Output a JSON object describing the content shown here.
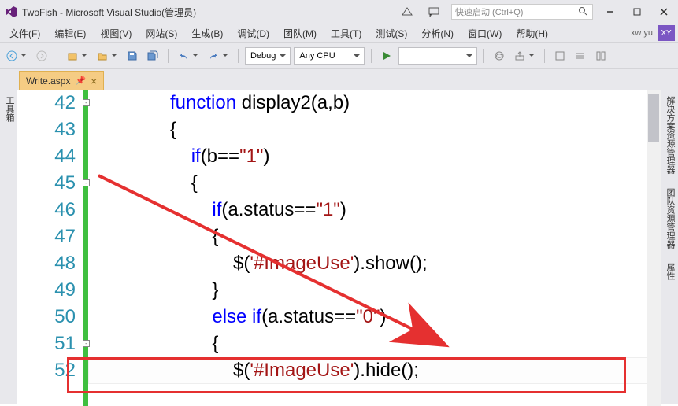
{
  "title": "TwoFish - Microsoft Visual Studio(管理员)",
  "quick_launch_placeholder": "快速启动 (Ctrl+Q)",
  "menu": {
    "file": "文件(F)",
    "edit": "编辑(E)",
    "view": "视图(V)",
    "site": "网站(S)",
    "build": "生成(B)",
    "debug": "调试(D)",
    "team": "团队(M)",
    "tools": "工具(T)",
    "test": "测试(S)",
    "analyze": "分析(N)",
    "window": "窗口(W)",
    "help": "帮助(H)"
  },
  "user": {
    "name": "xw yu",
    "initials": "XY"
  },
  "toolbar": {
    "config": "Debug",
    "platform": "Any CPU"
  },
  "tab": {
    "name": "Write.aspx"
  },
  "rails": {
    "left": "工具箱",
    "right": [
      "解决方案资源管理器",
      "团队资源管理器",
      "属性"
    ]
  },
  "code": {
    "lines": [
      {
        "n": 42,
        "fold": true,
        "indent": 3,
        "tokens": [
          {
            "t": "function ",
            "c": "kw"
          },
          {
            "t": "display2(a,b)"
          }
        ]
      },
      {
        "n": 43,
        "indent": 3,
        "tokens": [
          {
            "t": "{"
          }
        ]
      },
      {
        "n": 44,
        "indent": 4,
        "tokens": [
          {
            "t": "if",
            "c": "kw"
          },
          {
            "t": "(b=="
          },
          {
            "t": "\"1\"",
            "c": "str"
          },
          {
            "t": ")"
          }
        ]
      },
      {
        "n": 45,
        "fold": true,
        "indent": 4,
        "tokens": [
          {
            "t": "{"
          }
        ]
      },
      {
        "n": 46,
        "indent": 5,
        "tokens": [
          {
            "t": "if",
            "c": "kw"
          },
          {
            "t": "(a.status=="
          },
          {
            "t": "\"1\"",
            "c": "str"
          },
          {
            "t": ")"
          }
        ]
      },
      {
        "n": 47,
        "indent": 5,
        "tokens": [
          {
            "t": "{"
          }
        ]
      },
      {
        "n": 48,
        "indent": 6,
        "tokens": [
          {
            "t": "$("
          },
          {
            "t": "'#ImageUse'",
            "c": "str"
          },
          {
            "t": ").show();"
          }
        ]
      },
      {
        "n": 49,
        "indent": 5,
        "tokens": [
          {
            "t": "}"
          }
        ]
      },
      {
        "n": 50,
        "indent": 5,
        "tokens": [
          {
            "t": "else if",
            "c": "kw"
          },
          {
            "t": "(a.status=="
          },
          {
            "t": "\"0\"",
            "c": "str"
          },
          {
            "t": ")"
          }
        ]
      },
      {
        "n": 51,
        "fold": true,
        "indent": 5,
        "tokens": [
          {
            "t": "{"
          }
        ]
      },
      {
        "n": 52,
        "indent": 6,
        "current": true,
        "tokens": [
          {
            "t": "$("
          },
          {
            "t": "'#ImageUse'",
            "c": "str"
          },
          {
            "t": ").hide();"
          }
        ]
      }
    ]
  }
}
